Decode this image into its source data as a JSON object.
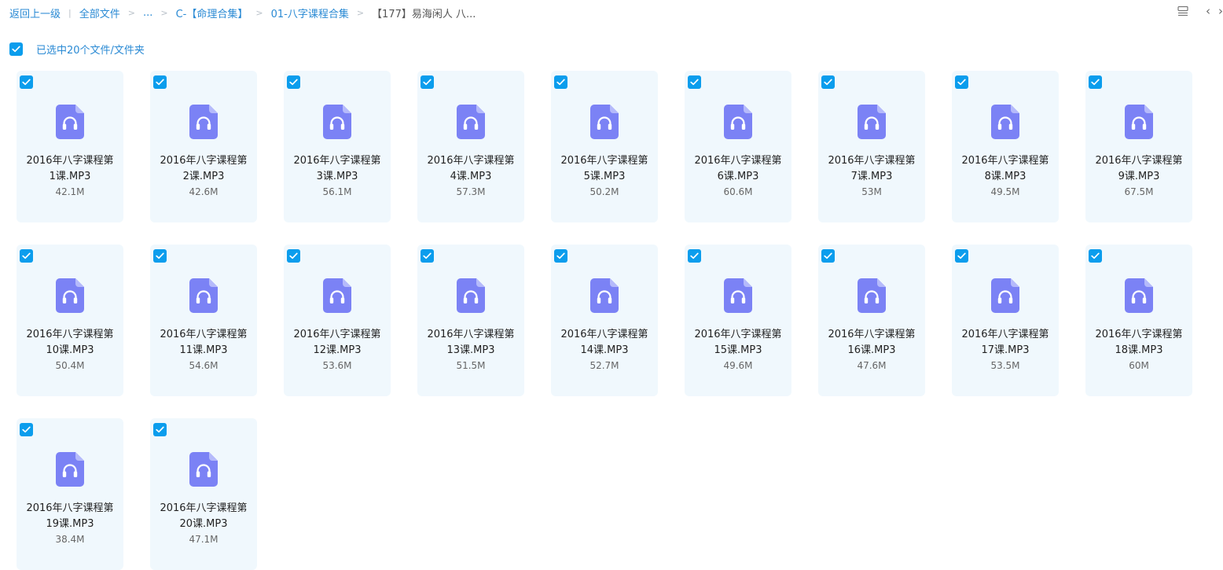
{
  "breadcrumb": {
    "back": "返回上一级",
    "all_files": "全部文件",
    "ellipsis": "...",
    "folder1": "C-【命理合集】",
    "folder2": "01-八字课程合集",
    "current": "【177】易海闲人 八..."
  },
  "toolbar": {
    "view_icon": "list-view-icon",
    "prev_arrow": "‹",
    "next_arrow": "›"
  },
  "selection": {
    "text": "已选中20个文件/文件夹",
    "checked": true
  },
  "colors": {
    "accent": "#0b9ded",
    "link": "#2a8ad4",
    "card_bg": "#f0f8fd",
    "icon": "#7b82f5"
  },
  "files": [
    {
      "line1": "2016年八字课程第",
      "line2": "1课.MP3",
      "size": "42.1M",
      "icon": "audio-file-icon",
      "checked": true
    },
    {
      "line1": "2016年八字课程第",
      "line2": "2课.MP3",
      "size": "42.6M",
      "icon": "audio-file-icon",
      "checked": true
    },
    {
      "line1": "2016年八字课程第",
      "line2": "3课.MP3",
      "size": "56.1M",
      "icon": "audio-file-icon",
      "checked": true
    },
    {
      "line1": "2016年八字课程第",
      "line2": "4课.MP3",
      "size": "57.3M",
      "icon": "audio-file-icon",
      "checked": true
    },
    {
      "line1": "2016年八字课程第",
      "line2": "5课.MP3",
      "size": "50.2M",
      "icon": "audio-file-icon",
      "checked": true
    },
    {
      "line1": "2016年八字课程第",
      "line2": "6课.MP3",
      "size": "60.6M",
      "icon": "audio-file-icon",
      "checked": true
    },
    {
      "line1": "2016年八字课程第",
      "line2": "7课.MP3",
      "size": "53M",
      "icon": "audio-file-icon",
      "checked": true
    },
    {
      "line1": "2016年八字课程第",
      "line2": "8课.MP3",
      "size": "49.5M",
      "icon": "audio-file-icon",
      "checked": true
    },
    {
      "line1": "2016年八字课程第",
      "line2": "9课.MP3",
      "size": "67.5M",
      "icon": "audio-file-icon",
      "checked": true
    },
    {
      "line1": "2016年八字课程第",
      "line2": "10课.MP3",
      "size": "50.4M",
      "icon": "audio-file-icon",
      "checked": true
    },
    {
      "line1": "2016年八字课程第",
      "line2": "11课.MP3",
      "size": "54.6M",
      "icon": "audio-file-icon",
      "checked": true
    },
    {
      "line1": "2016年八字课程第",
      "line2": "12课.MP3",
      "size": "53.6M",
      "icon": "audio-file-icon",
      "checked": true
    },
    {
      "line1": "2016年八字课程第",
      "line2": "13课.MP3",
      "size": "51.5M",
      "icon": "audio-file-icon",
      "checked": true
    },
    {
      "line1": "2016年八字课程第",
      "line2": "14课.MP3",
      "size": "52.7M",
      "icon": "audio-file-icon",
      "checked": true
    },
    {
      "line1": "2016年八字课程第",
      "line2": "15课.MP3",
      "size": "49.6M",
      "icon": "audio-file-icon",
      "checked": true
    },
    {
      "line1": "2016年八字课程第",
      "line2": "16课.MP3",
      "size": "47.6M",
      "icon": "audio-file-icon",
      "checked": true
    },
    {
      "line1": "2016年八字课程第",
      "line2": "17课.MP3",
      "size": "53.5M",
      "icon": "audio-file-icon",
      "checked": true
    },
    {
      "line1": "2016年八字课程第",
      "line2": "18课.MP3",
      "size": "60M",
      "icon": "audio-file-icon",
      "checked": true
    },
    {
      "line1": "2016年八字课程第",
      "line2": "19课.MP3",
      "size": "38.4M",
      "icon": "audio-file-icon",
      "checked": true
    },
    {
      "line1": "2016年八字课程第",
      "line2": "20课.MP3",
      "size": "47.1M",
      "icon": "audio-file-icon",
      "checked": true
    }
  ]
}
